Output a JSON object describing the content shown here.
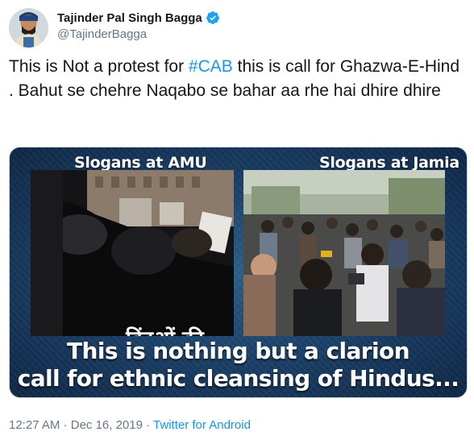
{
  "author": {
    "display_name": "Tajinder Pal Singh Bagga",
    "handle": "@TajinderBagga",
    "verified": true
  },
  "tweet": {
    "text_pre": "This is Not a protest for ",
    "hashtag": "#CAB",
    "text_post": " this is call for Ghazwa-E-Hind . Bahut se chehre Naqabo se bahar aa rhe hai dhire dhire"
  },
  "media": {
    "left_title": "Slogans at AMU",
    "right_title": "Slogans at Jamia",
    "hindi_caption": "हिंदुओं  की",
    "caption_line1": "This is nothing but a clarion",
    "caption_line2": "call for ethnic cleansing of Hindus..."
  },
  "meta": {
    "time": "12:27 AM",
    "separator": " · ",
    "date": "Dec 16, 2019",
    "separator2": " · ",
    "source": "Twitter for Android"
  },
  "colors": {
    "link": "#1b95e0",
    "secondary_text": "#657786",
    "verified_badge": "#1da1f2"
  },
  "icons": {
    "verified": "verified-badge-icon"
  }
}
